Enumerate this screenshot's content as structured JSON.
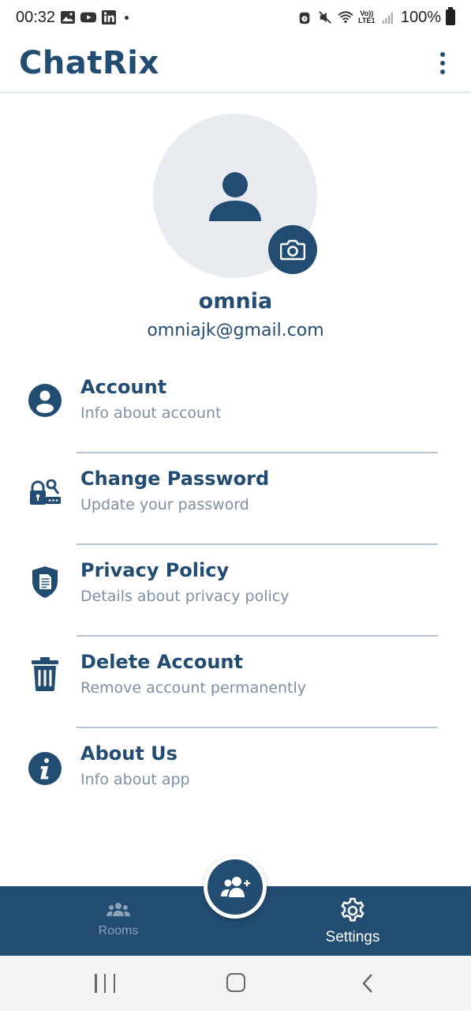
{
  "status_bar": {
    "time": "00:32",
    "battery": "100%",
    "left_icons": [
      "gallery-icon",
      "youtube-icon",
      "linkedin-icon",
      "dot-icon"
    ],
    "right_icons": [
      "alarm-icon",
      "mute-icon",
      "wifi-icon",
      "volte-icon",
      "signal-icon",
      "battery-icon"
    ],
    "volte_label": "Vo)) LTE1"
  },
  "app_bar": {
    "title": "ChatRix",
    "menu_icon": "kebab-menu-icon"
  },
  "profile": {
    "name": "omnia",
    "email": "omniajk@gmail.com",
    "avatar_icon": "person-icon",
    "camera_icon": "camera-icon"
  },
  "settings": {
    "items": [
      {
        "title": "Account",
        "subtitle": "Info about account",
        "icon": "account-circle-icon"
      },
      {
        "title": "Change Password",
        "subtitle": "Update your password",
        "icon": "lock-key-icon"
      },
      {
        "title": "Privacy Policy",
        "subtitle": "Details about privacy policy",
        "icon": "shield-document-icon"
      },
      {
        "title": "Delete Account",
        "subtitle": "Remove account permanently",
        "icon": "trash-icon"
      },
      {
        "title": "About Us",
        "subtitle": "Info about app",
        "icon": "info-icon"
      }
    ]
  },
  "bottom_nav": {
    "rooms_label": "Rooms",
    "settings_label": "Settings",
    "fab_icon": "add-user-icon",
    "active": "Settings"
  },
  "colors": {
    "primary": "#234c72",
    "avatar_bg": "#e8ecf1",
    "subtitle": "#7d8fa3",
    "divider": "#b8c4d1",
    "inactive_nav": "#8aa1b8"
  }
}
